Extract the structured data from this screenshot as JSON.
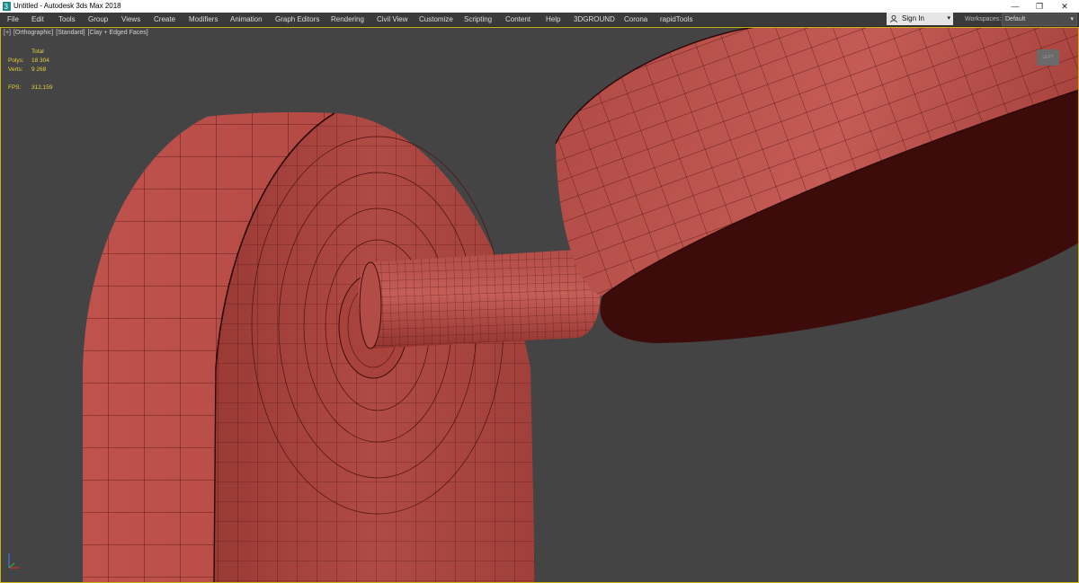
{
  "window": {
    "title": "Untitled - Autodesk 3ds Max 2018",
    "minimize": "—",
    "restore": "❐",
    "close": "✕"
  },
  "menu": {
    "items": [
      "File",
      "Edit",
      "Tools",
      "Group",
      "Views",
      "Create",
      "Modifiers",
      "Animation",
      "Graph Editors",
      "Rendering",
      "Civil View",
      "Customize",
      "Scripting",
      "Content",
      "Help",
      "3DGROUND",
      "Corona",
      "rapidTools"
    ]
  },
  "account": {
    "signin_label": "Sign In",
    "workspaces_label": "Workspaces:",
    "workspace_value": "Default",
    "dropdown_icon": "▾"
  },
  "viewport": {
    "label_parts": [
      "[+]",
      "[Orthographic]",
      "[Standard]",
      "[Clay + Edged Faces]"
    ],
    "stats": {
      "header": "Total",
      "polys_label": "Polys:",
      "polys_value": "18 304",
      "verts_label": "Verts:",
      "verts_value": "9 268",
      "fps_label": "FPS:",
      "fps_value": "312,159"
    },
    "viewcube_label": "LEFT"
  },
  "colors": {
    "viewport_bg": "#444444",
    "mesh_fill": "#b04a44",
    "mesh_side": "#c4554f",
    "mesh_shadow": "#3e0b0b",
    "wire": "#3a0c0a",
    "stats_text": "#e6d23c",
    "active_border": "#c8b414"
  }
}
